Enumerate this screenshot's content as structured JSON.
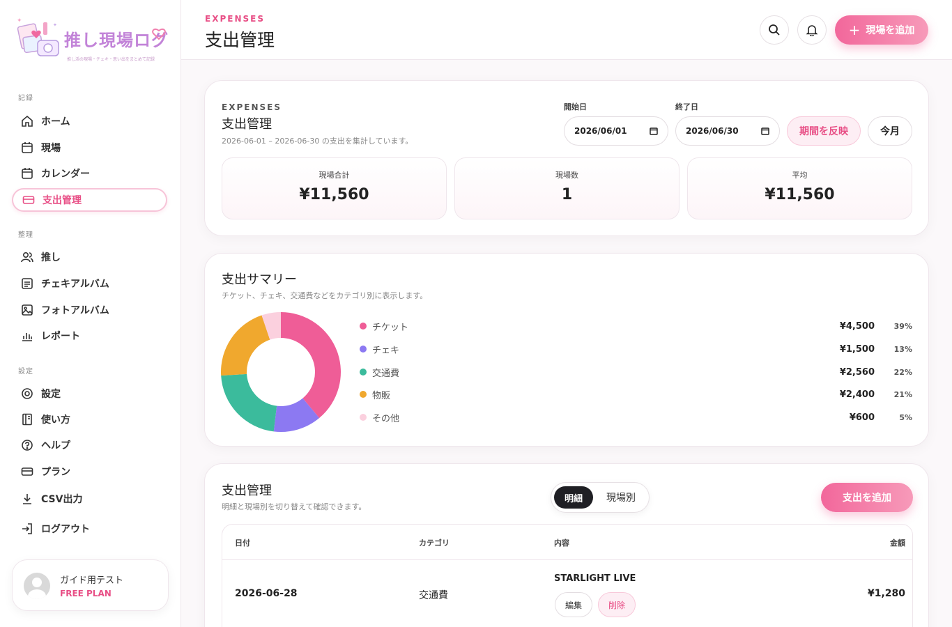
{
  "app": {
    "logo_title": "推し現場ログ",
    "logo_subtitle": "推し活の現場・チェキ・思い出をまとめて記録"
  },
  "sidebar": {
    "sections": [
      {
        "label": "記録"
      },
      {
        "label": "整理"
      },
      {
        "label": "設定"
      }
    ],
    "items": [
      {
        "label": "ホーム",
        "icon": "home-icon"
      },
      {
        "label": "現場",
        "icon": "calendar-icon"
      },
      {
        "label": "カレンダー",
        "icon": "calendar-icon"
      },
      {
        "label": "支出管理",
        "icon": "card-icon",
        "active": true
      },
      {
        "label": "推し",
        "icon": "users-icon"
      },
      {
        "label": "チェキアルバム",
        "icon": "album-icon"
      },
      {
        "label": "フォトアルバム",
        "icon": "image-icon"
      },
      {
        "label": "レポート",
        "icon": "bar-chart-icon"
      },
      {
        "label": "設定",
        "icon": "gear-icon"
      },
      {
        "label": "使い方",
        "icon": "book-icon"
      },
      {
        "label": "ヘルプ",
        "icon": "help-icon"
      },
      {
        "label": "プラン",
        "icon": "card-icon"
      },
      {
        "label": "CSV出力",
        "icon": "download-icon"
      },
      {
        "label": "ログアウト",
        "icon": "logout-icon"
      }
    ],
    "user": {
      "name": "ガイド用テスト",
      "plan": "FREE PLAN"
    }
  },
  "header": {
    "eyebrow": "EXPENSES",
    "title": "支出管理",
    "add_label": "現場を追加"
  },
  "filter": {
    "eyebrow": "EXPENSES",
    "title": "支出管理",
    "subtitle": "2026-06-01 – 2026-06-30 の支出を集計しています。",
    "start_label": "開始日",
    "start_value": "2026/06/01",
    "end_label": "終了日",
    "end_value": "2026/06/30",
    "apply_label": "期間を反映",
    "this_month_label": "今月",
    "stats": [
      {
        "label": "現場合計",
        "value": "¥11,560"
      },
      {
        "label": "現場数",
        "value": "1"
      },
      {
        "label": "平均",
        "value": "¥11,560"
      }
    ]
  },
  "summary": {
    "title": "支出サマリー",
    "subtitle": "チケット、チェキ、交通費などをカテゴリ別に表示します。"
  },
  "chart_data": {
    "type": "pie",
    "donut": true,
    "categories": [
      "チケット",
      "チェキ",
      "交通費",
      "物販",
      "その他"
    ],
    "values": [
      4500,
      1500,
      2560,
      2400,
      600
    ],
    "amount_labels": [
      "¥4,500",
      "¥1,500",
      "¥2,560",
      "¥2,400",
      "¥600"
    ],
    "percent_labels": [
      "39%",
      "13%",
      "22%",
      "21%",
      "5%"
    ],
    "colors": [
      "#ef5d97",
      "#8c79f2",
      "#3bbb9c",
      "#f0a82e",
      "#fbd0de"
    ],
    "legend_position": "right"
  },
  "expenses": {
    "title": "支出管理",
    "subtitle": "明細と現場別を切り替えて確認できます。",
    "tab_detail": "明細",
    "tab_by_event": "現場別",
    "add_label": "支出を追加",
    "columns": [
      "日付",
      "カテゴリ",
      "内容",
      "金額"
    ],
    "rows": [
      {
        "date": "2026-06-28",
        "category": "交通費",
        "content": "STARLIGHT LIVE",
        "amount": "¥1,280",
        "edit": "編集",
        "delete": "削除"
      }
    ]
  }
}
